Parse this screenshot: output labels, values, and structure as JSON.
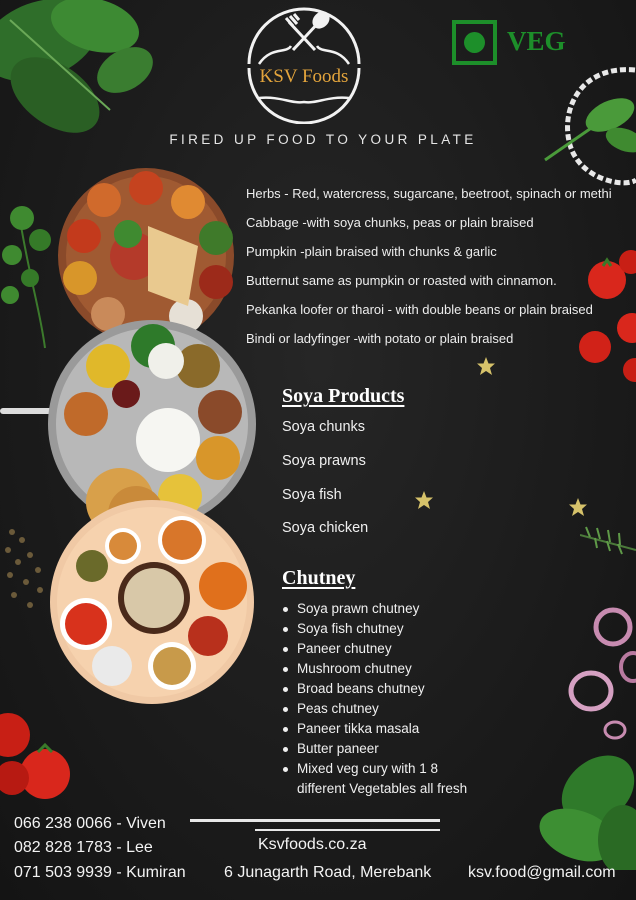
{
  "header": {
    "brand": "KSV Foods",
    "tagline": "FIRED UP FOOD TO YOUR PLATE",
    "veg_label": "VEG"
  },
  "vegetables": [
    "Herbs - Red, watercress, sugarcane, beetroot, spinach or methi",
    "Cabbage -with soya chunks, peas or plain braised",
    "Pumpkin -plain braised with chunks & garlic",
    "Butternut same as pumpkin or roasted with cinnamon.",
    "Pekanka loofer or tharoi - with double beans or plain braised",
    "Bindi or ladyfinger -with potato or plain braised"
  ],
  "soya": {
    "title": "Soya Products",
    "items": [
      "Soya chunks",
      "Soya prawns",
      "Soya fish",
      "Soya chicken"
    ]
  },
  "chutney": {
    "title": "Chutney",
    "items": [
      "Soya prawn chutney",
      "Soya fish chutney",
      "Paneer chutney",
      "Mushroom chutney",
      "Broad beans chutney",
      "Peas chutney",
      "Paneer tikka masala",
      "Butter paneer",
      "Mixed veg cury with 1 8",
      "different Vegetables all fresh"
    ]
  },
  "contacts": {
    "phone1": "066 238 0066 - Viven",
    "phone2": "082 828 1783 - Lee",
    "phone3": "071 503 9939 - Kumiran",
    "website": "Ksvfoods.co.za",
    "address": "6 Junagarth Road, Merebank",
    "email": "ksv.food@gmail.com"
  },
  "colors": {
    "background": "#1c1c1c",
    "brand_orange": "#e3a43c",
    "veg_green": "#1d8f2a",
    "text": "#f0f0f0"
  }
}
